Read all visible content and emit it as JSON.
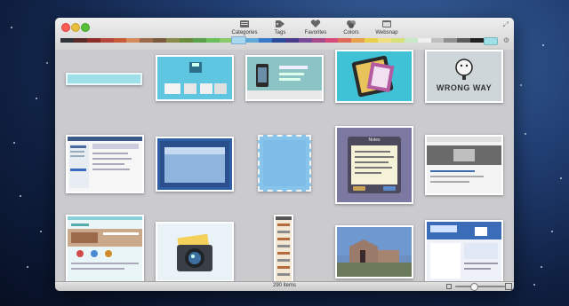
{
  "toolbar": {
    "items": [
      {
        "label": "Categories",
        "icon": "categories-icon"
      },
      {
        "label": "Tags",
        "icon": "tags-icon"
      },
      {
        "label": "Favorites",
        "icon": "favorites-icon"
      },
      {
        "label": "Colors",
        "icon": "colors-icon"
      },
      {
        "label": "Websnap",
        "icon": "websnap-icon"
      }
    ]
  },
  "color_swatches": [
    "#303438",
    "#5a2a26",
    "#8b2e2a",
    "#b6463a",
    "#c85a3a",
    "#d58a5a",
    "#9a6a4a",
    "#7a5a3c",
    "#8a8a4a",
    "#6a8a3c",
    "#5aa04a",
    "#6abf5a",
    "#88c96a",
    "#a8d8f0",
    "#5fa8d8",
    "#3a78c8",
    "#2a4a9a",
    "#4a3a8a",
    "#7a4a9a",
    "#a84a8a",
    "#d84a7a",
    "#e06a5a",
    "#e8a04a",
    "#e8d04a",
    "#f0e080",
    "#d8e07a",
    "#c8e8c8",
    "#f0f0f0",
    "#c0c0c0",
    "#909090",
    "#5a5a5a",
    "#202020"
  ],
  "selected_swatch_index": 13,
  "thumbnails": [
    {
      "name": "blank-light-blue"
    },
    {
      "name": "floppy-disk-app"
    },
    {
      "name": "iphone-site"
    },
    {
      "name": "ipad-book"
    },
    {
      "name": "wrong-way-sign",
      "caption": "WRONG WAY"
    },
    {
      "name": "web-admin-page"
    },
    {
      "name": "blue-window-frame"
    },
    {
      "name": "blue-stamp"
    },
    {
      "name": "notes-dialog",
      "title": "Notes"
    },
    {
      "name": "web-signin-page"
    },
    {
      "name": "website-layout"
    },
    {
      "name": "camera-icon-art"
    },
    {
      "name": "tall-web-strip"
    },
    {
      "name": "church-photo"
    },
    {
      "name": "1password-site"
    }
  ],
  "status": {
    "item_count": "290 items"
  }
}
